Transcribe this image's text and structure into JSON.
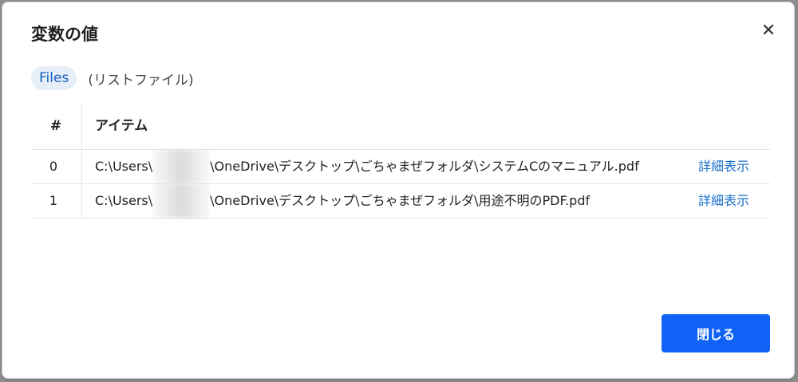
{
  "dialog": {
    "title": "変数の値",
    "close_glyph": "✕",
    "variable_name": "Files",
    "variable_type": "(リストファイル)"
  },
  "table": {
    "headers": {
      "index": "#",
      "item": "アイテム"
    },
    "rows": [
      {
        "index": "0",
        "path_prefix": "C:\\Users\\",
        "path_suffix": "\\OneDrive\\デスクトップ\\ごちゃまぜフォルダ\\システムCのマニュアル.pdf",
        "link": "詳細表示"
      },
      {
        "index": "1",
        "path_prefix": "C:\\Users\\",
        "path_suffix": "\\OneDrive\\デスクトップ\\ごちゃまぜフォルダ\\用途不明のPDF.pdf",
        "link": "詳細表示"
      }
    ]
  },
  "footer": {
    "close_label": "閉じる"
  },
  "colors": {
    "accent": "#0f62f5",
    "link": "#1a6fc9",
    "chip_bg": "#e6eef8"
  },
  "icons": {
    "close": "close-icon"
  }
}
